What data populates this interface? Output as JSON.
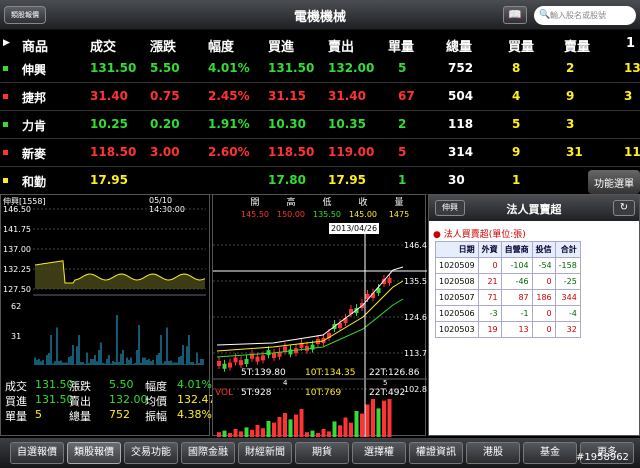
{
  "topbar": {
    "category_button": "類股報價",
    "title": "電機機械",
    "book_icon": "book-icon",
    "search_placeholder": "輸入股名或股號"
  },
  "columns": [
    "商品",
    "成交",
    "漲跌",
    "幅度",
    "買進",
    "賣出",
    "單量",
    "總量",
    "買量",
    "賣量",
    "1"
  ],
  "rows": [
    {
      "name": "伸興",
      "price": "131.50",
      "change": "5.50",
      "pct": "4.01%",
      "bid": "131.50",
      "ask": "132.00",
      "vol": "5",
      "total": "752",
      "bidvol": "8",
      "askvol": "2",
      "extra": "13",
      "color": "g",
      "marker": "#33dd33"
    },
    {
      "name": "捷邦",
      "price": "31.40",
      "change": "0.75",
      "pct": "2.45%",
      "bid": "31.15",
      "ask": "31.40",
      "vol": "67",
      "total": "504",
      "bidvol": "4",
      "askvol": "9",
      "extra": "3",
      "color": "r",
      "marker": "#ff3333"
    },
    {
      "name": "力肯",
      "price": "10.25",
      "change": "0.20",
      "pct": "1.91%",
      "bid": "10.30",
      "ask": "10.35",
      "vol": "2",
      "total": "118",
      "bidvol": "5",
      "askvol": "3",
      "extra": "",
      "color": "g",
      "marker": "#33dd33"
    },
    {
      "name": "新麥",
      "price": "118.50",
      "change": "3.00",
      "pct": "2.60%",
      "bid": "118.50",
      "ask": "119.00",
      "vol": "5",
      "total": "314",
      "bidvol": "9",
      "askvol": "31",
      "extra": "11",
      "color": "r",
      "marker": "#ff3333"
    },
    {
      "name": "和勤",
      "price": "17.95",
      "change": "",
      "pct": "",
      "bid": "17.80",
      "ask": "17.95",
      "vol": "1",
      "total": "30",
      "bidvol": "1",
      "askvol": "",
      "extra": "",
      "color": "y",
      "marker": "#ffee22"
    }
  ],
  "function_button": "功能選單",
  "intraday": {
    "title": "伸興[1558]",
    "time": "05/10 14:30:00",
    "y_labels": [
      "146.50",
      "141.75",
      "137.00",
      "132.25",
      "127.50"
    ],
    "vol_labels": [
      "62",
      "31"
    ],
    "stats": [
      [
        "成交",
        "131.50",
        "漲跌",
        "5.50",
        "幅度",
        "4.01%"
      ],
      [
        "買進",
        "131.50",
        "賣出",
        "132.00",
        "均價",
        "132.47"
      ],
      [
        "單量",
        "5",
        "總量",
        "752",
        "振幅",
        "4.38%"
      ]
    ]
  },
  "kline": {
    "headers": [
      "開",
      "高",
      "低",
      "收",
      "量"
    ],
    "values": [
      "145.50",
      "150.00",
      "135.50",
      "145.00",
      "1475"
    ],
    "date": "2013/04/26",
    "y_labels": [
      "146.4",
      "135.5",
      "124.6",
      "113.7",
      "102.8"
    ],
    "ma5": "5T:139.80",
    "ma10": "10T:134.35",
    "ma22": "22T:126.86",
    "vol_label": "VOL",
    "vol5": "5T:928",
    "vol10": "10T:769",
    "vol22": "22T:492",
    "marks": [
      "4",
      "5"
    ]
  },
  "institutional": {
    "button": "伸興",
    "title": "法人買賣超",
    "subtitle": "法人買賣超(單位:張)",
    "headers": [
      "日期",
      "外資",
      "自營商",
      "投信",
      "合計"
    ],
    "rows": [
      [
        "1020509",
        "0",
        "-104",
        "-54",
        "-158"
      ],
      [
        "1020508",
        "21",
        "-46",
        "0",
        "-25"
      ],
      [
        "1020507",
        "71",
        "87",
        "186",
        "344"
      ],
      [
        "1020506",
        "-3",
        "-1",
        "0",
        "-4"
      ],
      [
        "1020503",
        "19",
        "13",
        "0",
        "32"
      ]
    ]
  },
  "bottom_tabs": [
    "自選報價",
    "類股報價",
    "交易功能",
    "國際金融",
    "財經新聞",
    "期貨",
    "選擇權",
    "權證資訊",
    "港股",
    "基金",
    "更多"
  ],
  "watermark": "#1958962"
}
